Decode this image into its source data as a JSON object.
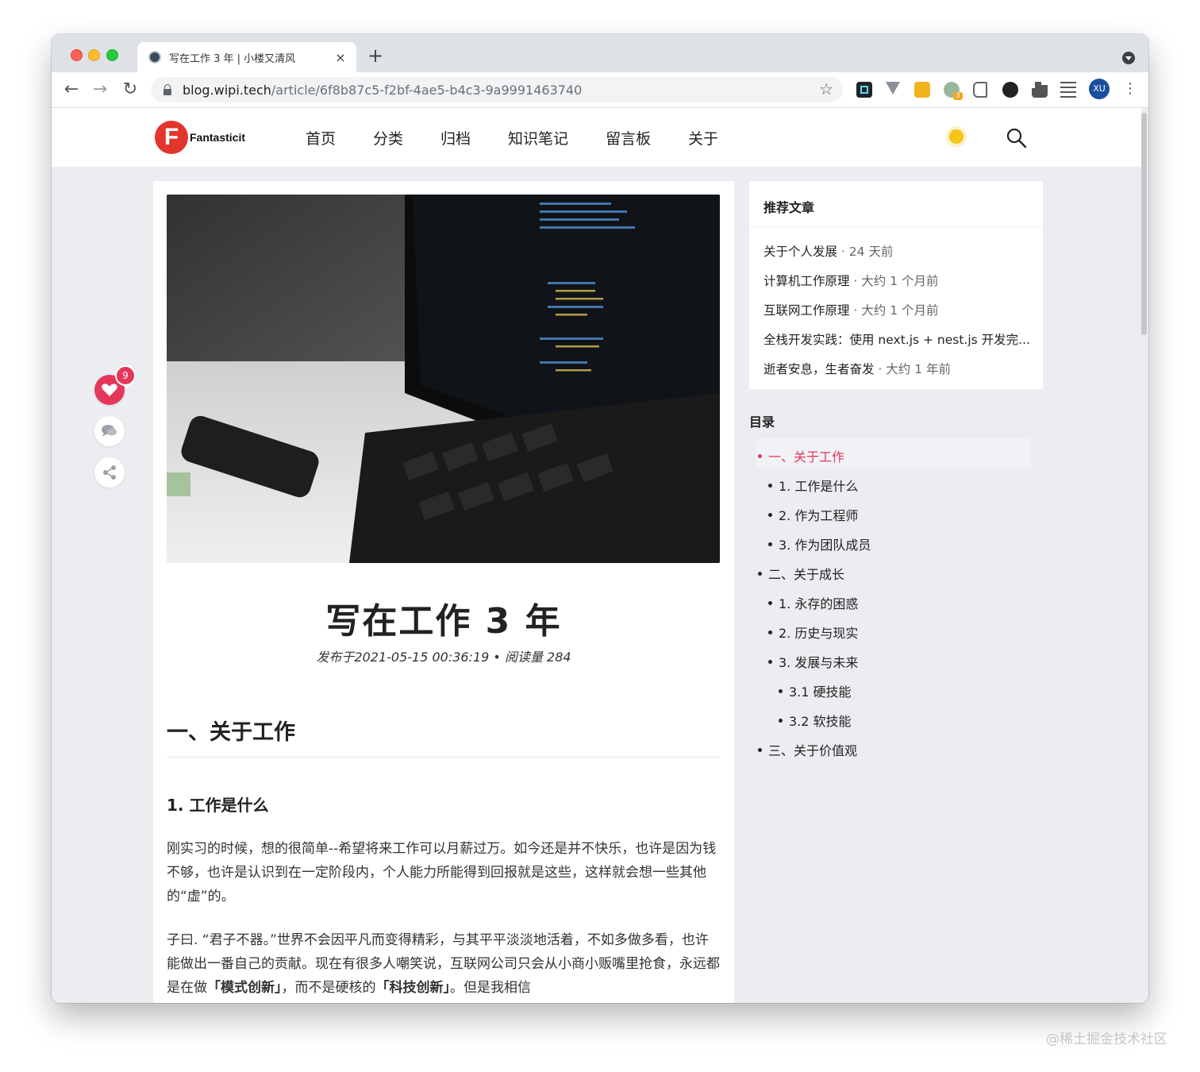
{
  "browser": {
    "tab_title": "写在工作 3 年 | 小楼又清风",
    "tab_close": "×",
    "new_tab": "+",
    "url_host": "blog.wipi.tech",
    "url_path": "/article/6f8b87c5-f2bf-4ae5-b4c3-9a9991463740",
    "profile_initials": "XU",
    "extension_badge": "3",
    "nav_back": "←",
    "nav_forward": "→",
    "nav_reload": "↻",
    "bookmark_star": "☆",
    "menu": "⋮"
  },
  "site": {
    "logo_letter": "F",
    "logo_text": "Fantasticit",
    "nav": [
      "首页",
      "分类",
      "归档",
      "知识笔记",
      "留言板",
      "关于"
    ]
  },
  "actions": {
    "like_count": "9"
  },
  "article": {
    "title": "写在工作 3 年",
    "meta": "发布于2021-05-15 00:36:19 • 阅读量 284",
    "h1": "一、关于工作",
    "h3": "1. 工作是什么",
    "para1": "刚实习的时候，想的很简单--希望将来工作可以月薪过万。如今还是并不快乐，也许是因为钱不够，也许是认识到在一定阶段内，个人能力所能得到回报就是这些，这样就会想一些其他的“虚”的。",
    "para2_a": "子曰. “君子不器。”世界不会因平凡而变得精彩，与其平平淡淡地活着，不如多做多看，也许能做出一番自己的贡献。现在有很多人嘲笑说，互联网公司只会从小商小贩嘴里抢食，永远都是在做",
    "para2_b": "「模式创新」",
    "para2_c": "，而不是硬核的",
    "para2_d": "「科技创新」",
    "para2_e": "。但是我相信"
  },
  "recommend": {
    "title": "推荐文章",
    "items": [
      {
        "name": "关于个人发展",
        "when": " · 24 天前"
      },
      {
        "name": "计算机工作原理",
        "when": " · 大约 1 个月前"
      },
      {
        "name": "互联网工作原理",
        "when": " · 大约 1 个月前"
      },
      {
        "name": "全栈开发实践：使用 next.js + nest.js 开发完...",
        "when": ""
      },
      {
        "name": "逝者安息，生者奋发",
        "when": " · 大约 1 年前"
      }
    ]
  },
  "toc": {
    "title": "目录",
    "items": [
      {
        "label": "一、关于工作",
        "level": 1,
        "active": true
      },
      {
        "label": "1. 工作是什么",
        "level": 2
      },
      {
        "label": "2. 作为工程师",
        "level": 2
      },
      {
        "label": "3. 作为团队成员",
        "level": 2
      },
      {
        "label": "二、关于成长",
        "level": 1
      },
      {
        "label": "1. 永存的困惑",
        "level": 2
      },
      {
        "label": "2. 历史与现实",
        "level": 2
      },
      {
        "label": "3. 发展与未来",
        "level": 2
      },
      {
        "label": "3.1 硬技能",
        "level": 3
      },
      {
        "label": "3.2 软技能",
        "level": 3
      },
      {
        "label": "三、关于价值观",
        "level": 1
      }
    ]
  },
  "watermark": "@稀土掘金技术社区",
  "colors": {
    "accent": "#e5375a",
    "page_bg": "#ebedf0",
    "logo_red": "#e2352c"
  }
}
